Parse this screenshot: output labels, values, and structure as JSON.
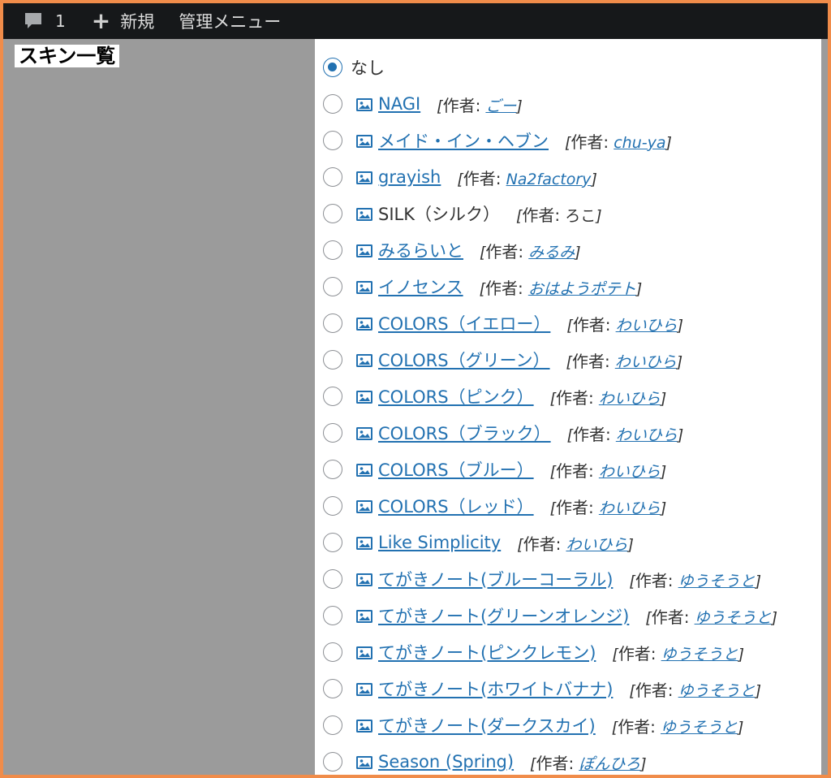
{
  "admin_bar": {
    "comments_count": "1",
    "new_label": "新規",
    "menu_label": "管理メニュー"
  },
  "section_title": "スキン一覧",
  "none_option": {
    "label": "なし",
    "checked": true
  },
  "author_prefix": "作者:",
  "skins": [
    {
      "name": "NAGI",
      "author": "ごー",
      "name_link": true,
      "author_link": true
    },
    {
      "name": "メイド・イン・ヘブン",
      "author": "chu-ya",
      "name_link": true,
      "author_link": true
    },
    {
      "name": "grayish",
      "author": "Na2factory",
      "name_link": true,
      "author_link": true
    },
    {
      "name": "SILK（シルク）",
      "author": "ろこ",
      "name_link": false,
      "author_link": false
    },
    {
      "name": "みるらいと",
      "author": "みるみ",
      "name_link": true,
      "author_link": true
    },
    {
      "name": "イノセンス",
      "author": "おはようポテト",
      "name_link": true,
      "author_link": true
    },
    {
      "name": "COLORS（イエロー）",
      "author": "わいひら",
      "name_link": true,
      "author_link": true
    },
    {
      "name": "COLORS（グリーン）",
      "author": "わいひら",
      "name_link": true,
      "author_link": true
    },
    {
      "name": "COLORS（ピンク）",
      "author": "わいひら",
      "name_link": true,
      "author_link": true
    },
    {
      "name": "COLORS（ブラック）",
      "author": "わいひら",
      "name_link": true,
      "author_link": true
    },
    {
      "name": "COLORS（ブルー）",
      "author": "わいひら",
      "name_link": true,
      "author_link": true
    },
    {
      "name": "COLORS（レッド）",
      "author": "わいひら",
      "name_link": true,
      "author_link": true
    },
    {
      "name": "Like Simplicity",
      "author": "わいひら",
      "name_link": true,
      "author_link": true
    },
    {
      "name": "てがきノート(ブルーコーラル)",
      "author": "ゆうそうと",
      "name_link": true,
      "author_link": true
    },
    {
      "name": "てがきノート(グリーンオレンジ)",
      "author": "ゆうそうと",
      "name_link": true,
      "author_link": true
    },
    {
      "name": "てがきノート(ピンクレモン)",
      "author": "ゆうそうと",
      "name_link": true,
      "author_link": true
    },
    {
      "name": "てがきノート(ホワイトバナナ)",
      "author": "ゆうそうと",
      "name_link": true,
      "author_link": true
    },
    {
      "name": "てがきノート(ダークスカイ)",
      "author": "ゆうそうと",
      "name_link": true,
      "author_link": true
    },
    {
      "name": "Season (Spring)",
      "author": "ぽんひろ",
      "name_link": true,
      "author_link": true
    }
  ],
  "colors": {
    "link": "#2271b1",
    "admin_bar": "#16181a",
    "border": "#f08c4a",
    "side_gray": "#9b9b9b"
  }
}
